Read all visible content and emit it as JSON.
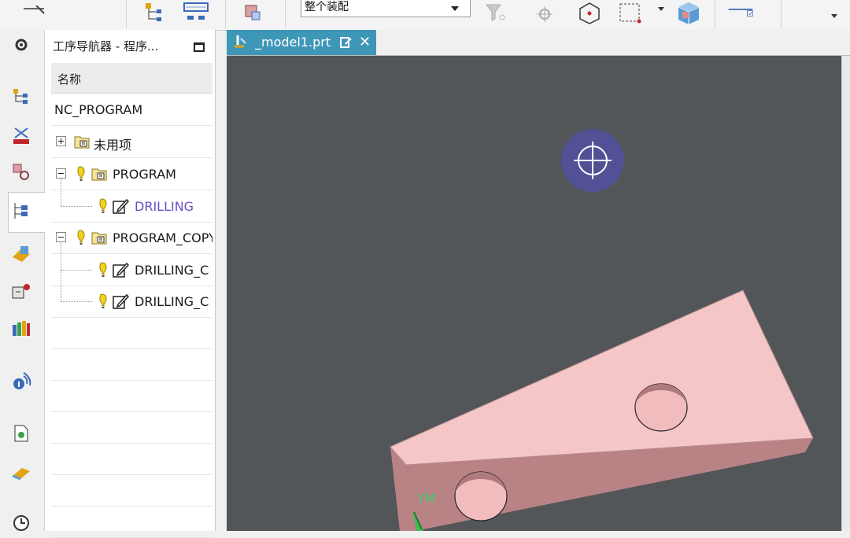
{
  "toolbar": {
    "filter_value": "整个装配"
  },
  "navigator": {
    "title": "工序导航器 - 程序...",
    "column_header": "名称",
    "rows": [
      {
        "label": "NC_PROGRAM"
      },
      {
        "label": "未用项"
      },
      {
        "label": "PROGRAM"
      },
      {
        "label": "DRILLING"
      },
      {
        "label": "PROGRAM_COPY"
      },
      {
        "label": "DRILLING_C"
      },
      {
        "label": "DRILLING_C"
      }
    ]
  },
  "document": {
    "tab_label": "_model1.prt",
    "close_glyph": "✕"
  },
  "viewport": {
    "triad_label": "YM"
  },
  "colors": {
    "tab_active": "#3f97b8",
    "viewport_bg": "#535659",
    "part_top": "#f4c6c8",
    "part_side": "#b98386",
    "active_operation_text": "#6a4fc8",
    "cursor_halo": "#5250a0"
  }
}
